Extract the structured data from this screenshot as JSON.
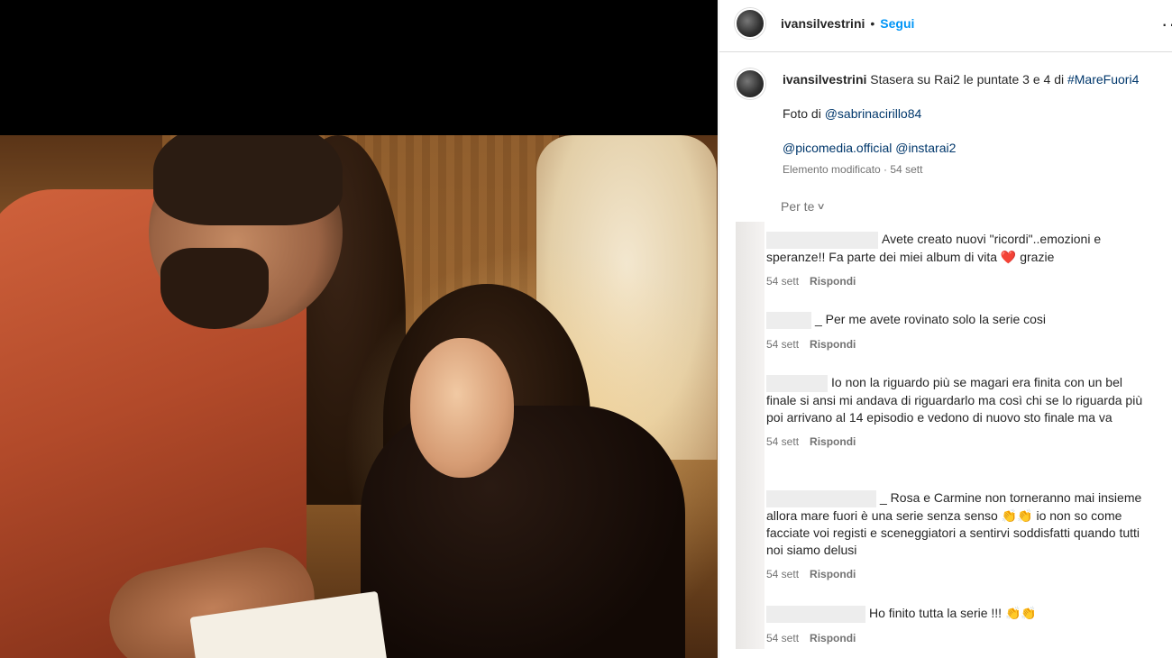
{
  "post": {
    "username": "ivansilvestrini",
    "follow_label": "Segui",
    "separator": "•",
    "more": "··"
  },
  "caption": {
    "username": "ivansilvestrini",
    "text": "Stasera su Rai2 le puntate 3 e 4 di",
    "hashtag": "#MareFuori4",
    "photo_by": "Foto di",
    "photo_mention": "@sabrinacirillo84",
    "mention_1": "@picomedia.official",
    "mention_2": "@instarai2",
    "meta": "Elemento modificato · 54 sett"
  },
  "filter": {
    "label": "Per te",
    "chevron": "∨"
  },
  "comments": [
    {
      "text_before": "Avete creato nuovi \"ricordi\"..emozioni e speranze!! Fa parte dei miei album di vita",
      "emoji": "❤️",
      "text_after": "grazie",
      "time": "54 sett",
      "reply": "Rispondi"
    },
    {
      "text": "_ Per me avete rovinato solo la serie cosi",
      "time": "54 sett",
      "reply": "Rispondi"
    },
    {
      "text": "Io non la riguardo più se magari era finita con un bel finale si ansi mi andava di riguardarlo ma così chi se lo riguarda più poi arrivano al 14 episodio e vedono di nuovo sto finale ma va",
      "time": "54 sett",
      "reply": "Rispondi"
    },
    {
      "text_before": "_ Rosa e Carmine non torneranno mai insieme allora mare fuori è una serie senza senso",
      "emoji": "👏👏",
      "text_after": "io non so come facciate voi registi e sceneggiatori a sentirvi soddisfatti quando tutti noi siamo delusi",
      "time": "54 sett",
      "reply": "Rispondi"
    },
    {
      "text": "Ho finito tutta la serie !!!",
      "emoji": "👏👏",
      "time": "54 sett",
      "reply": "Rispondi"
    }
  ]
}
